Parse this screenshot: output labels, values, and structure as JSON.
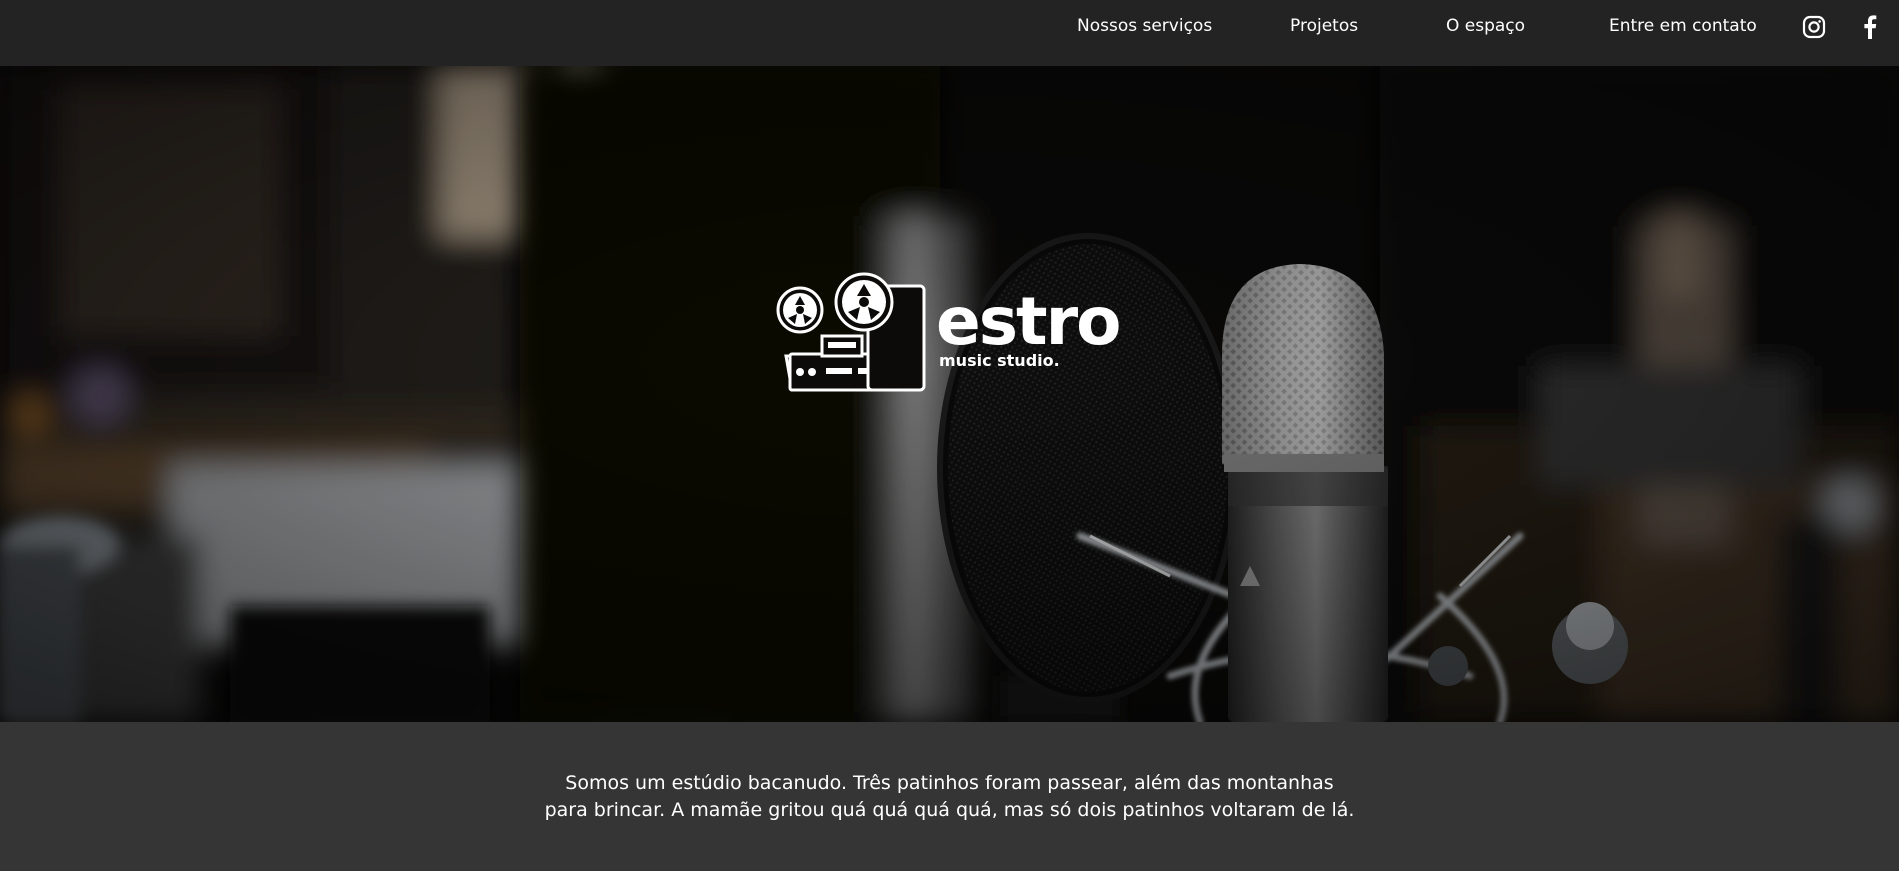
{
  "nav": {
    "items": [
      {
        "label": "Nossos serviços"
      },
      {
        "label": "Projetos"
      },
      {
        "label": "O espaço"
      },
      {
        "label": "Entre em contato"
      }
    ],
    "social": [
      {
        "icon": "instagram-icon"
      },
      {
        "icon": "facebook-icon"
      }
    ]
  },
  "hero": {
    "logo": {
      "name": "estro",
      "tagline": "music studio."
    }
  },
  "intro": {
    "line1": "Somos um estúdio bacanudo. Três patinhos foram passear, além das montanhas",
    "line2": "para brincar. A mamãe gritou quá quá quá quá, mas só dois patinhos voltaram de lá."
  },
  "colors": {
    "topbar": "#232323",
    "intro_bg": "#353535",
    "text": "#ffffff"
  }
}
